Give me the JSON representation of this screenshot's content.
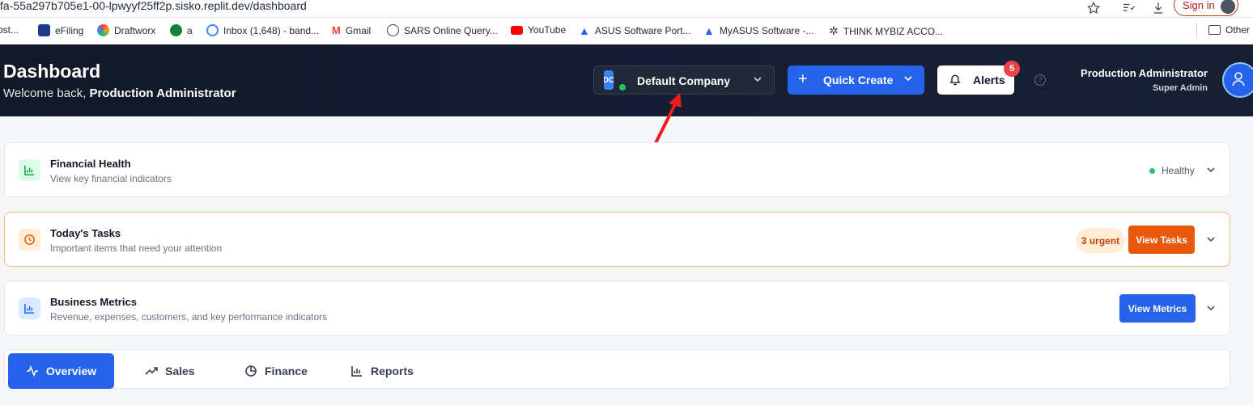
{
  "browser": {
    "url": "fa-55a297b705e1-00-lpwyyf25ff2p.sisko.replit.dev/dashboard",
    "signin_label": "Sign in",
    "bookmarks": [
      {
        "label": "ost...",
        "icon": "bookmark-icon"
      },
      {
        "label": "eFiling",
        "icon": "efiling-icon"
      },
      {
        "label": "Draftworx",
        "icon": "draftworx-icon"
      },
      {
        "label": "a",
        "icon": "globe-green-icon"
      },
      {
        "label": "Inbox (1,648) - band...",
        "icon": "google-icon"
      },
      {
        "label": "Gmail",
        "icon": "gmail-icon"
      },
      {
        "label": "SARS Online Query...",
        "icon": "globe-icon"
      },
      {
        "label": "YouTube",
        "icon": "youtube-icon"
      },
      {
        "label": "ASUS Software Port...",
        "icon": "asus-icon"
      },
      {
        "label": "MyASUS Software -...",
        "icon": "asus-icon"
      },
      {
        "label": "THINK MYBIZ ACCO...",
        "icon": "openai-icon"
      },
      {
        "label": "Other",
        "icon": "folder-icon"
      }
    ]
  },
  "header": {
    "title": "Dashboard",
    "welcome_prefix": "Welcome back,",
    "welcome_name": "Production Administrator",
    "company": {
      "badge": "DC",
      "name": "Default Company"
    },
    "quick_create_label": "Quick Create",
    "alerts_label": "Alerts",
    "alerts_count": "5",
    "user": {
      "name": "Production Administrator",
      "role": "Super Admin"
    }
  },
  "cards": {
    "financial_health": {
      "title": "Financial Health",
      "subtitle": "View key financial indicators",
      "status": "Healthy"
    },
    "todays_tasks": {
      "title": "Today's Tasks",
      "subtitle": "Important items that need your attention",
      "badge": "3 urgent",
      "button": "View Tasks"
    },
    "business_metrics": {
      "title": "Business Metrics",
      "subtitle": "Revenue, expenses, customers, and key performance indicators",
      "button": "View Metrics"
    }
  },
  "tabs": [
    {
      "label": "Overview",
      "icon": "activity-icon",
      "active": true
    },
    {
      "label": "Sales",
      "icon": "trending-up-icon",
      "active": false
    },
    {
      "label": "Finance",
      "icon": "pie-chart-icon",
      "active": false
    },
    {
      "label": "Reports",
      "icon": "bar-chart-icon",
      "active": false
    }
  ],
  "colors": {
    "accent": "#2563eb",
    "tasks": "#ea580c",
    "healthy": "#22c55e",
    "header_bg": "#111827"
  }
}
